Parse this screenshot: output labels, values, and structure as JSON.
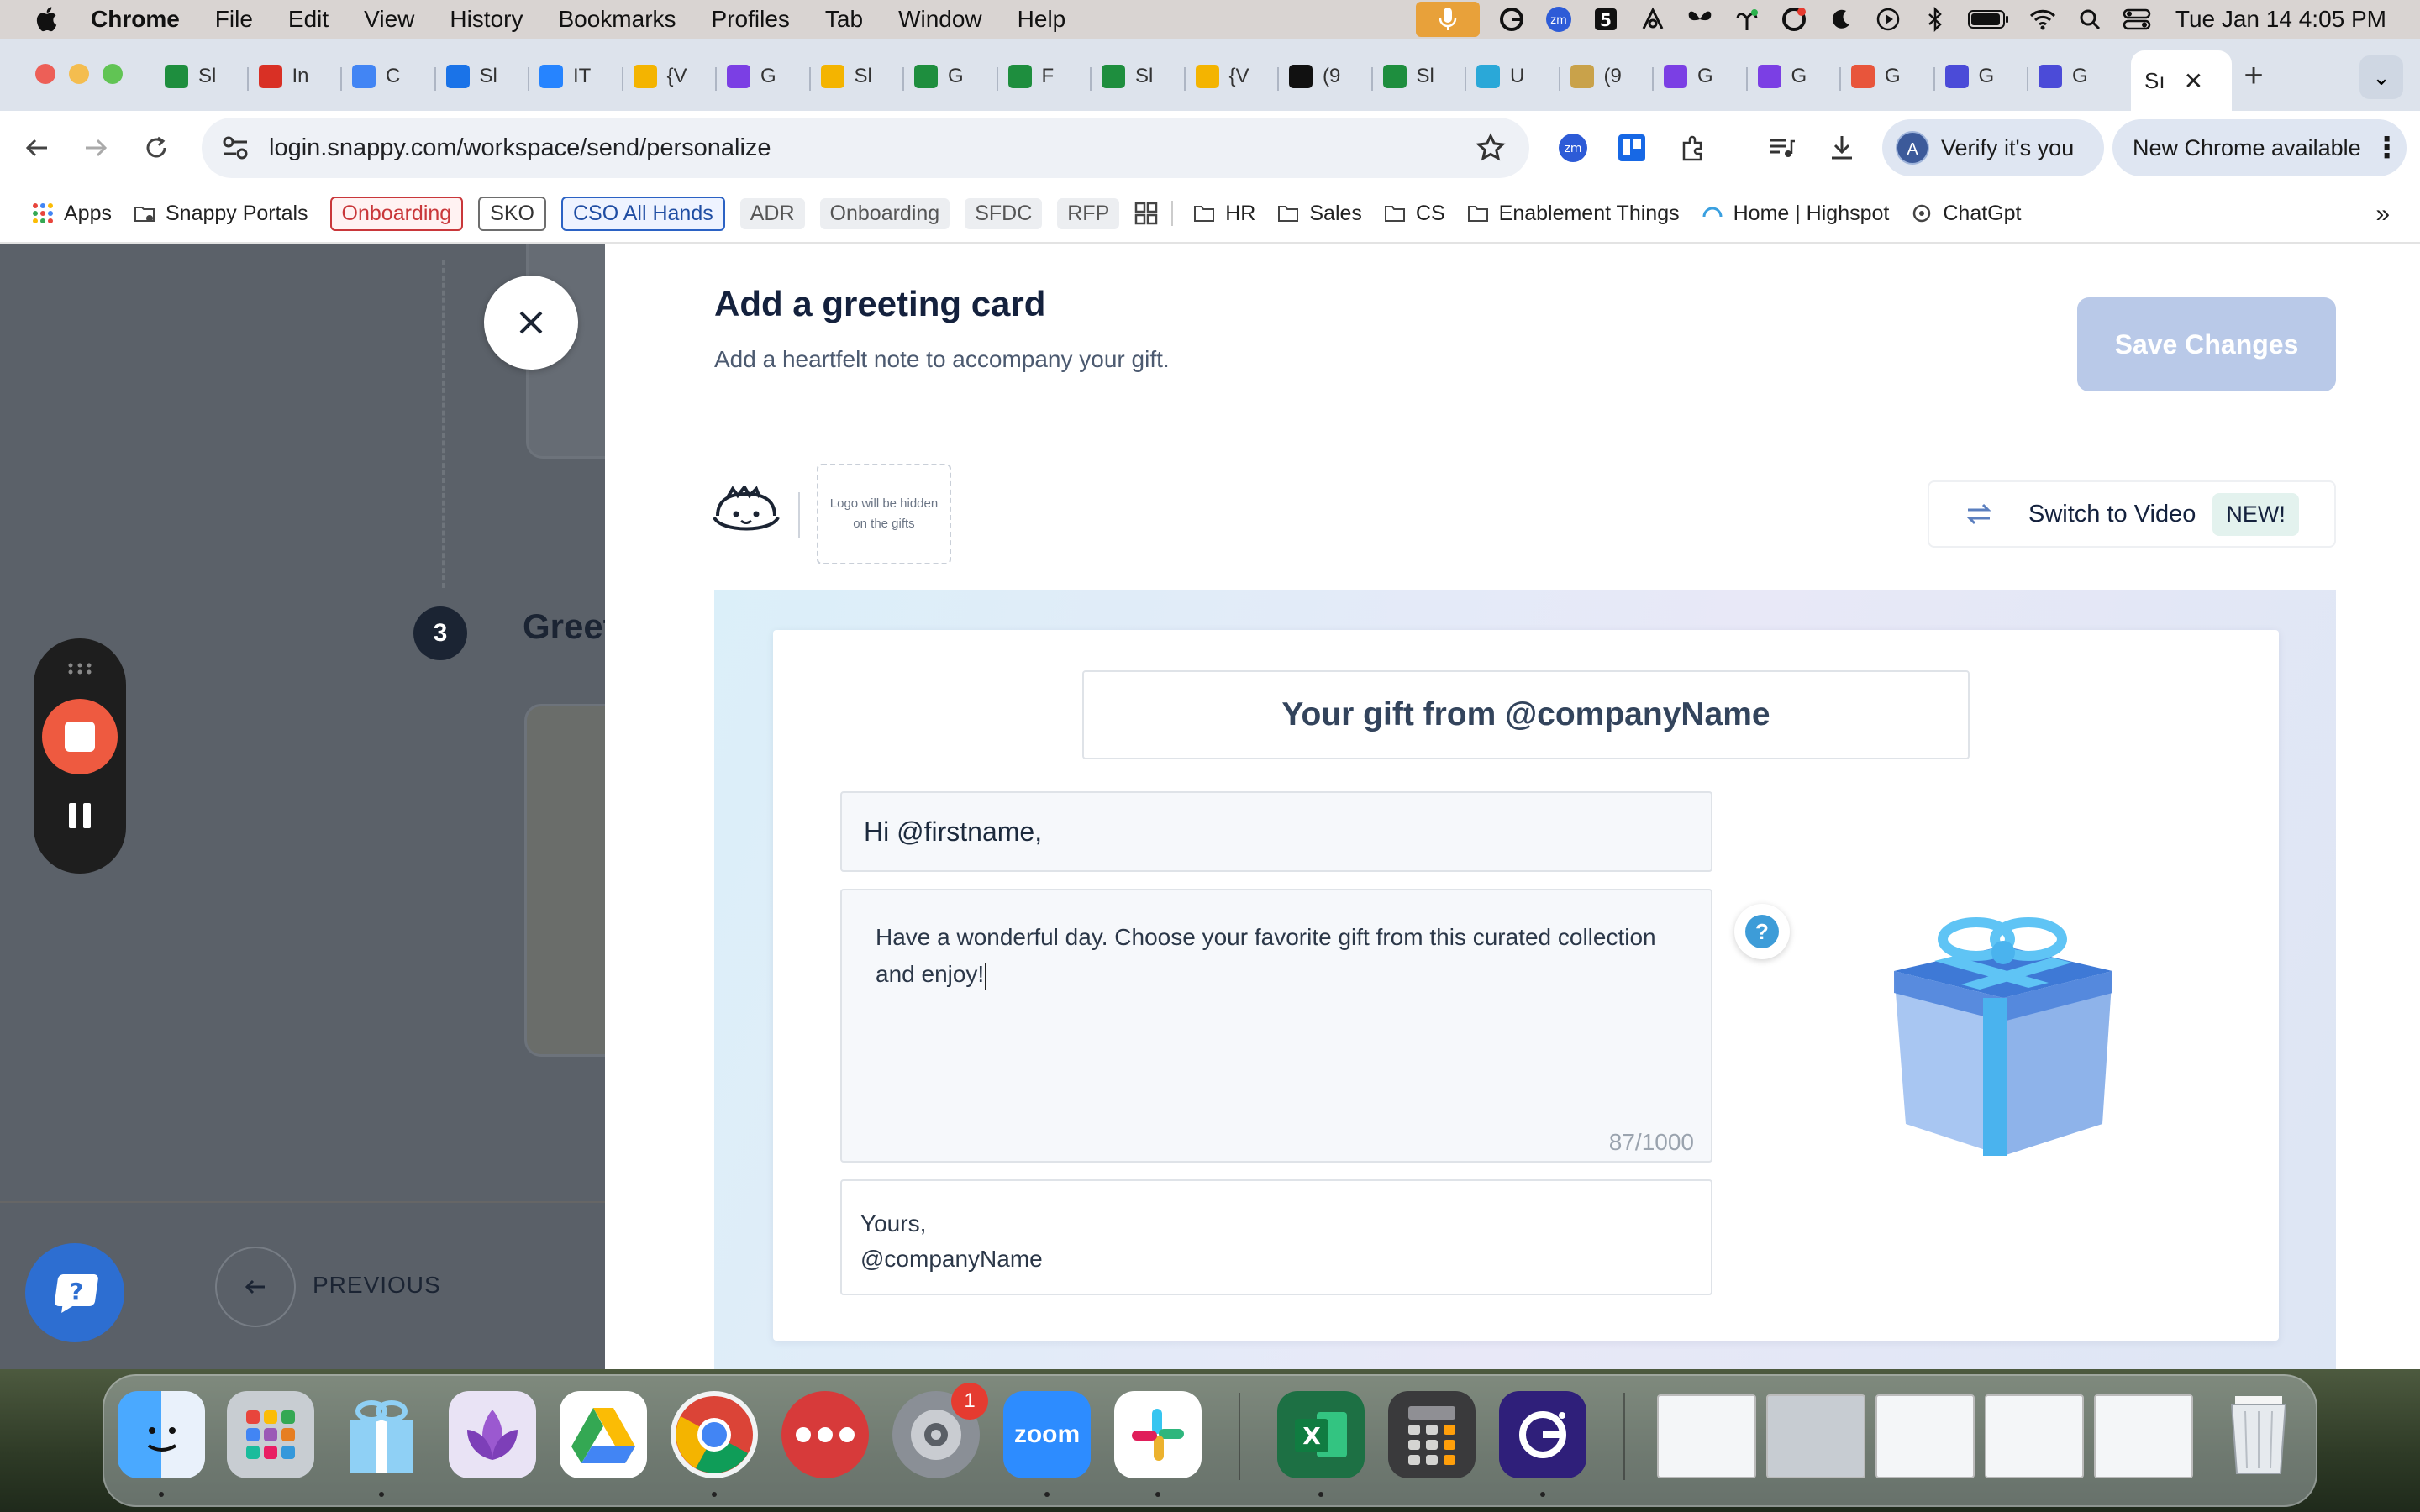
{
  "menubar": {
    "app_name": "Chrome",
    "items": [
      "File",
      "Edit",
      "View",
      "History",
      "Bookmarks",
      "Profiles",
      "Tab",
      "Window",
      "Help"
    ],
    "clock": "Tue Jan 14  4:05 PM"
  },
  "tabs": {
    "items": [
      {
        "label": "Sl",
        "icon": "sheets-icon",
        "color": "#1e8e3e"
      },
      {
        "label": "In",
        "icon": "gmail-icon",
        "color": "#d93025"
      },
      {
        "label": "C",
        "icon": "box-icon",
        "color": "#4285f4"
      },
      {
        "label": "Sl",
        "icon": "calendar-icon",
        "color": "#1a73e8"
      },
      {
        "label": "IT",
        "icon": "jira-icon",
        "color": "#2684ff"
      },
      {
        "label": "{V",
        "icon": "slides-icon",
        "color": "#f4b400"
      },
      {
        "label": "G",
        "icon": "gong-icon",
        "color": "#7b3fe4"
      },
      {
        "label": "Sl",
        "icon": "slides-icon",
        "color": "#f4b400"
      },
      {
        "label": "G",
        "icon": "sheets-icon",
        "color": "#1e8e3e"
      },
      {
        "label": "F",
        "icon": "sheets-icon",
        "color": "#1e8e3e"
      },
      {
        "label": "Sl",
        "icon": "sheets-icon",
        "color": "#1e8e3e"
      },
      {
        "label": "{V",
        "icon": "slides-icon",
        "color": "#f4b400"
      },
      {
        "label": "(9",
        "icon": "notion-icon",
        "color": "#111111"
      },
      {
        "label": "Sl",
        "icon": "sheets-icon",
        "color": "#1e8e3e"
      },
      {
        "label": "U",
        "icon": "u-icon",
        "color": "#2aa8d8"
      },
      {
        "label": "(9",
        "icon": "image-icon",
        "color": "#c9a24a"
      },
      {
        "label": "G",
        "icon": "gong-icon",
        "color": "#7b3fe4"
      },
      {
        "label": "G",
        "icon": "gong-icon",
        "color": "#7b3fe4"
      },
      {
        "label": "G",
        "icon": "rainbow-icon",
        "color": "#e8553b"
      },
      {
        "label": "G",
        "icon": "g-icon",
        "color": "#4b4bd8"
      },
      {
        "label": "G",
        "icon": "g-icon",
        "color": "#4b4bd8"
      }
    ],
    "active_label": "Sı"
  },
  "toolbar": {
    "url": "login.snappy.com/workspace/send/personalize",
    "verify_label": "Verify it's you",
    "avatar_letter": "A",
    "new_chrome_label": "New Chrome available"
  },
  "bookmarks": {
    "apps": "Apps",
    "snappy_portals": "Snappy Portals",
    "pills": {
      "onboarding_red": "Onboarding",
      "sko": "SKO",
      "cso": "CSO All Hands",
      "adr": "ADR",
      "onboarding": "Onboarding",
      "sfdc": "SFDC",
      "rfp": "RFP"
    },
    "folders": [
      "HR",
      "Sales",
      "CS",
      "Enablement Things"
    ],
    "highspot": "Home | Highspot",
    "chatgpt": "ChatGpt"
  },
  "background_page": {
    "step_number": "3",
    "step_title": "Greet",
    "previous_label": "PREVIOUS"
  },
  "drawer": {
    "title": "Add a greeting card",
    "subtitle": "Add a heartfelt note to accompany your gift.",
    "save_label": "Save Changes",
    "logo_placeholder": "Logo will be hidden on the gifts",
    "switch_video_label": "Switch to Video",
    "new_badge": "NEW!",
    "card": {
      "subject": "Your gift from @companyName",
      "greeting": "Hi @firstname,",
      "message": "Have a wonderful day. Choose your favorite gift from this curated collection and enjoy!",
      "char_count": "87/1000",
      "signoff_line1": "Yours,",
      "signoff_line2": "@companyName"
    }
  },
  "dock": {
    "settings_badge": "1",
    "zoom_label": "zoom"
  },
  "colors": {
    "accent": "#14213d",
    "save_disabled": "#b9c9e8",
    "stop_red": "#ee5a40"
  }
}
